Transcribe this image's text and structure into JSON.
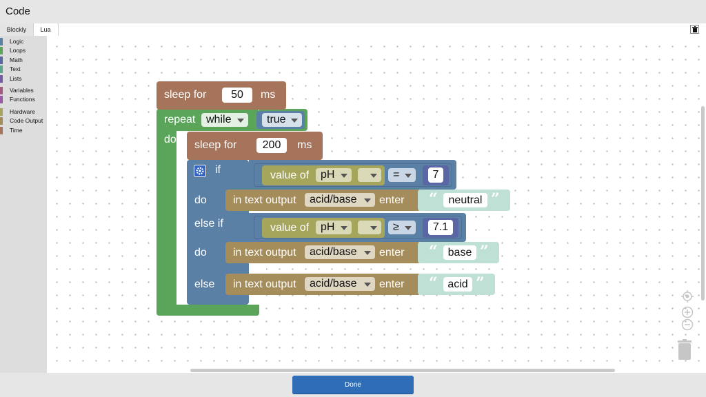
{
  "window": {
    "title": "Code"
  },
  "tabs": [
    {
      "label": "Blockly",
      "active": true
    },
    {
      "label": "Lua",
      "active": false
    }
  ],
  "toolbox": {
    "categories": [
      {
        "label": "Logic",
        "color": "#5b80a5"
      },
      {
        "label": "Loops",
        "color": "#5ba55b"
      },
      {
        "label": "Math",
        "color": "#5b67a5"
      },
      {
        "label": "Text",
        "color": "#5ba58c"
      },
      {
        "label": "Lists",
        "color": "#745ba5"
      },
      {
        "label": "Variables",
        "color": "#a55b80"
      },
      {
        "label": "Functions",
        "color": "#995ba5"
      },
      {
        "label": "Hardware",
        "color": "#a5a55b"
      },
      {
        "label": "Code Output",
        "color": "#a58c5b"
      },
      {
        "label": "Time",
        "color": "#a5745b"
      }
    ]
  },
  "blocks": {
    "sleep1": {
      "label": "sleep for",
      "value": "50",
      "unit": "ms"
    },
    "repeat": {
      "label": "repeat",
      "mode": "while",
      "do_label": "do",
      "condition": "true"
    },
    "sleep2": {
      "label": "sleep for",
      "value": "200",
      "unit": "ms"
    },
    "ifblock": {
      "if_label": "if",
      "do_label": "do",
      "elseif_label": "else if",
      "do2_label": "do",
      "else_label": "else"
    },
    "cond1": {
      "label": "value of",
      "var": "pH",
      "op": "=",
      "num": "7"
    },
    "cond2": {
      "label": "value of",
      "var": "pH",
      "op": "≥",
      "num": "7.1"
    },
    "out1": {
      "label": "in text output",
      "target": "acid/base",
      "enter": "enter",
      "text": "neutral"
    },
    "out2": {
      "label": "in text output",
      "target": "acid/base",
      "enter": "enter",
      "text": "base"
    },
    "out3": {
      "label": "in text output",
      "target": "acid/base",
      "enter": "enter",
      "text": "acid"
    }
  },
  "footer": {
    "done_label": "Done"
  },
  "colors": {
    "time": "#a5745b",
    "loops": "#5ba55b",
    "logic": "#5b80a5",
    "hardware": "#a5a55b",
    "output": "#a58c5b",
    "text": "#bfe0d4",
    "math": "#5b67a5"
  }
}
